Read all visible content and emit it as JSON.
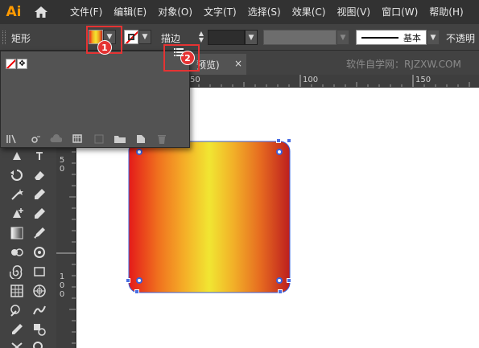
{
  "app": {
    "logo": "Ai"
  },
  "menu": [
    "文件(F)",
    "编辑(E)",
    "对象(O)",
    "文字(T)",
    "选择(S)",
    "效果(C)",
    "视图(V)",
    "窗口(W)",
    "帮助(H)"
  ],
  "control": {
    "shape_label": "矩形",
    "stroke_label": "描边",
    "brush_label": "基本",
    "opacity_label": "不透明"
  },
  "tab": {
    "title": "预览)",
    "close": "×"
  },
  "watermark": "软件自学网：RJZXW.COM",
  "ruler": {
    "h_labels": [
      "50",
      "100",
      "150"
    ],
    "v_labels": [
      "5 0",
      "1 0 0"
    ]
  },
  "swatch_panel": {
    "registration_glyph": "✥"
  },
  "annotations": [
    {
      "label": "1"
    },
    {
      "label": "2"
    }
  ],
  "colors": {
    "gradient_stops": [
      "#e41a1a",
      "#f5b028",
      "#f1e632",
      "#e66a20",
      "#bd1e1e"
    ],
    "callout": "#e53333",
    "selection": "#3b5fd9"
  }
}
